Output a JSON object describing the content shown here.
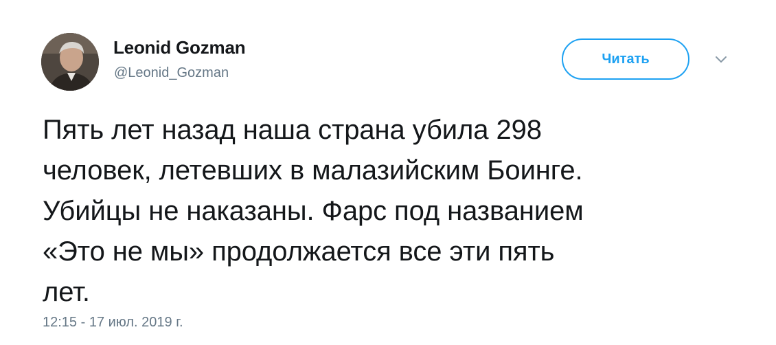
{
  "author": {
    "name": "Leonid Gozman",
    "handle": "@Leonid_Gozman"
  },
  "follow_button": {
    "label": "Читать"
  },
  "more_icon": "chevron-down-icon",
  "tweet": {
    "text": "Пять лет назад наша страна убила 298\nчеловек, летевших в малазийским Боинге.\nУбийцы не наказаны. Фарс под названием\n«Это не мы» продолжается все эти пять\nлет.",
    "timestamp": "12:15 - 17 июл. 2019 г."
  },
  "colors": {
    "accent": "#1da1f2",
    "text": "#14171a",
    "secondary": "#657786"
  }
}
